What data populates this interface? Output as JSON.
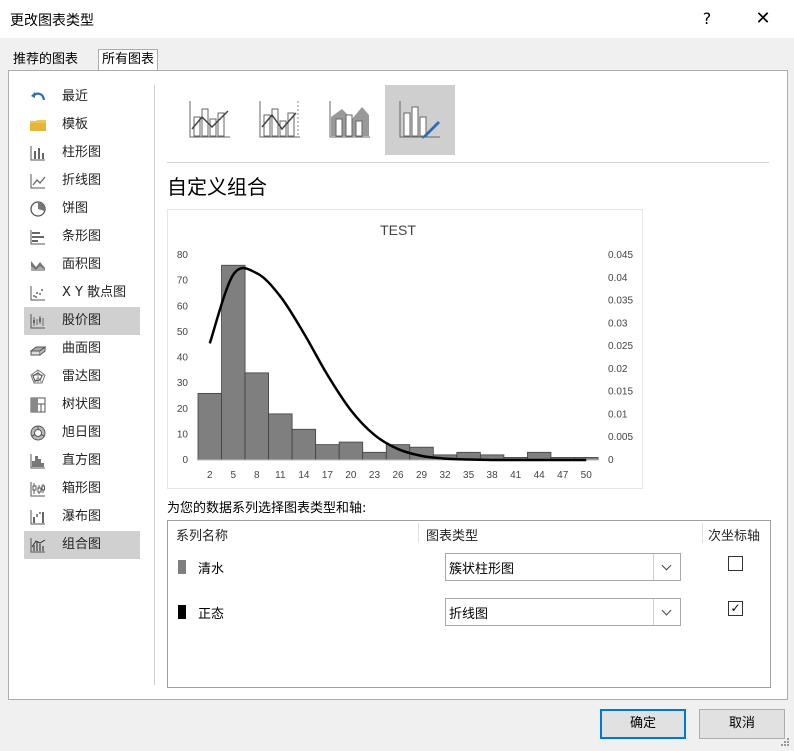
{
  "window": {
    "title": "更改图表类型",
    "help": "?",
    "close": "✕"
  },
  "tabs": [
    {
      "label": "推荐的图表"
    },
    {
      "label": "所有图表"
    }
  ],
  "sidebar": {
    "items": [
      {
        "label": "最近",
        "icon": "undo-icon"
      },
      {
        "label": "模板",
        "icon": "folder-icon"
      },
      {
        "label": "柱形图",
        "icon": "column-chart-icon"
      },
      {
        "label": "折线图",
        "icon": "line-chart-icon"
      },
      {
        "label": "饼图",
        "icon": "pie-chart-icon"
      },
      {
        "label": "条形图",
        "icon": "bar-chart-icon"
      },
      {
        "label": "面积图",
        "icon": "area-chart-icon"
      },
      {
        "label": "X Y 散点图",
        "icon": "scatter-chart-icon"
      },
      {
        "label": "股价图",
        "icon": "stock-chart-icon"
      },
      {
        "label": "曲面图",
        "icon": "surface-chart-icon"
      },
      {
        "label": "雷达图",
        "icon": "radar-chart-icon"
      },
      {
        "label": "树状图",
        "icon": "treemap-chart-icon"
      },
      {
        "label": "旭日图",
        "icon": "sunburst-chart-icon"
      },
      {
        "label": "直方图",
        "icon": "histogram-chart-icon"
      },
      {
        "label": "箱形图",
        "icon": "boxplot-chart-icon"
      },
      {
        "label": "瀑布图",
        "icon": "waterfall-chart-icon"
      },
      {
        "label": "组合图",
        "icon": "combo-chart-icon"
      }
    ],
    "hover_index": 8,
    "selected_index": 16
  },
  "combo": {
    "title": "自定义组合",
    "selected_type_index": 3,
    "series_heading": "为您的数据系列选择图表类型和轴:",
    "columns": {
      "name": "系列名称",
      "type": "图表类型",
      "secondary": "次坐标轴"
    },
    "series": [
      {
        "name": "清水",
        "type": "簇状柱形图",
        "secondary": false,
        "color": "#7f7f7f"
      },
      {
        "name": "正态",
        "type": "折线图",
        "secondary": true,
        "color": "#000000",
        "check_mark": "✓"
      }
    ]
  },
  "buttons": {
    "ok": "确定",
    "cancel": "取消"
  },
  "chart_data": {
    "type": "bar",
    "title": "TEST",
    "categories": [
      "2",
      "5",
      "8",
      "11",
      "14",
      "17",
      "20",
      "23",
      "26",
      "29",
      "32",
      "35",
      "38",
      "41",
      "44",
      "47",
      "50"
    ],
    "series": [
      {
        "name": "清水",
        "type": "bar",
        "axis": "primary",
        "values": [
          26,
          76,
          34,
          18,
          12,
          6,
          7,
          3,
          6,
          5,
          2,
          3,
          2,
          1,
          3,
          1,
          1
        ],
        "color": "#7f7f7f"
      },
      {
        "name": "正态",
        "type": "line",
        "axis": "secondary",
        "values": [
          0.0256,
          0.0407,
          0.041,
          0.0359,
          0.0278,
          0.0187,
          0.0109,
          0.0055,
          0.0024,
          0.0009,
          0.0003,
          0.0001,
          0,
          0,
          0,
          0,
          0
        ],
        "color": "#000000"
      }
    ],
    "ylim": [
      0,
      80
    ],
    "yticks": [
      "0",
      "10",
      "20",
      "30",
      "40",
      "50",
      "60",
      "70",
      "80"
    ],
    "y2lim": [
      0,
      0.045
    ],
    "y2ticks": [
      "0",
      "0.005",
      "0.01",
      "0.015",
      "0.02",
      "0.025",
      "0.03",
      "0.035",
      "0.04",
      "0.045"
    ],
    "grid": false,
    "legend": "none"
  }
}
